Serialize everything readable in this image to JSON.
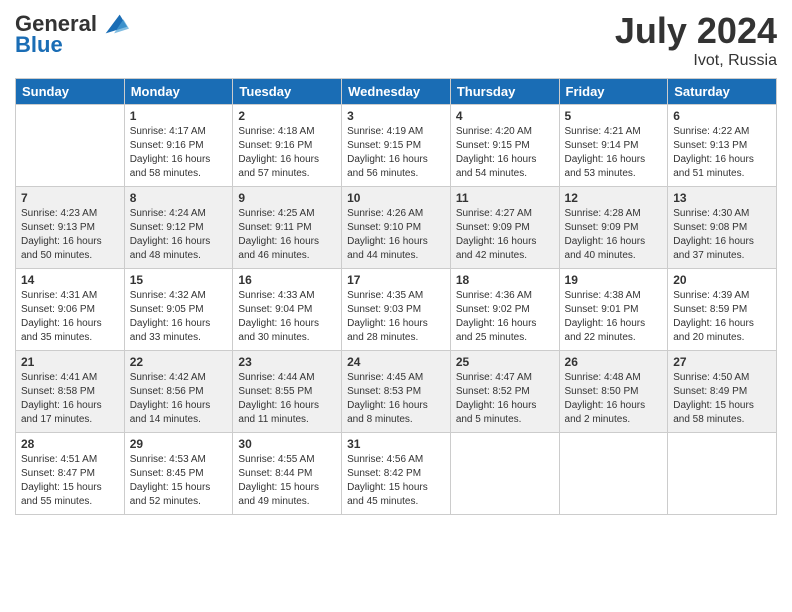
{
  "header": {
    "logo_line1": "General",
    "logo_line2": "Blue",
    "month_title": "July 2024",
    "location": "Ivot, Russia"
  },
  "weekdays": [
    "Sunday",
    "Monday",
    "Tuesday",
    "Wednesday",
    "Thursday",
    "Friday",
    "Saturday"
  ],
  "weeks": [
    [
      {
        "day": "",
        "content": ""
      },
      {
        "day": "1",
        "content": "Sunrise: 4:17 AM\nSunset: 9:16 PM\nDaylight: 16 hours\nand 58 minutes."
      },
      {
        "day": "2",
        "content": "Sunrise: 4:18 AM\nSunset: 9:16 PM\nDaylight: 16 hours\nand 57 minutes."
      },
      {
        "day": "3",
        "content": "Sunrise: 4:19 AM\nSunset: 9:15 PM\nDaylight: 16 hours\nand 56 minutes."
      },
      {
        "day": "4",
        "content": "Sunrise: 4:20 AM\nSunset: 9:15 PM\nDaylight: 16 hours\nand 54 minutes."
      },
      {
        "day": "5",
        "content": "Sunrise: 4:21 AM\nSunset: 9:14 PM\nDaylight: 16 hours\nand 53 minutes."
      },
      {
        "day": "6",
        "content": "Sunrise: 4:22 AM\nSunset: 9:13 PM\nDaylight: 16 hours\nand 51 minutes."
      }
    ],
    [
      {
        "day": "7",
        "content": "Sunrise: 4:23 AM\nSunset: 9:13 PM\nDaylight: 16 hours\nand 50 minutes."
      },
      {
        "day": "8",
        "content": "Sunrise: 4:24 AM\nSunset: 9:12 PM\nDaylight: 16 hours\nand 48 minutes."
      },
      {
        "day": "9",
        "content": "Sunrise: 4:25 AM\nSunset: 9:11 PM\nDaylight: 16 hours\nand 46 minutes."
      },
      {
        "day": "10",
        "content": "Sunrise: 4:26 AM\nSunset: 9:10 PM\nDaylight: 16 hours\nand 44 minutes."
      },
      {
        "day": "11",
        "content": "Sunrise: 4:27 AM\nSunset: 9:09 PM\nDaylight: 16 hours\nand 42 minutes."
      },
      {
        "day": "12",
        "content": "Sunrise: 4:28 AM\nSunset: 9:09 PM\nDaylight: 16 hours\nand 40 minutes."
      },
      {
        "day": "13",
        "content": "Sunrise: 4:30 AM\nSunset: 9:08 PM\nDaylight: 16 hours\nand 37 minutes."
      }
    ],
    [
      {
        "day": "14",
        "content": "Sunrise: 4:31 AM\nSunset: 9:06 PM\nDaylight: 16 hours\nand 35 minutes."
      },
      {
        "day": "15",
        "content": "Sunrise: 4:32 AM\nSunset: 9:05 PM\nDaylight: 16 hours\nand 33 minutes."
      },
      {
        "day": "16",
        "content": "Sunrise: 4:33 AM\nSunset: 9:04 PM\nDaylight: 16 hours\nand 30 minutes."
      },
      {
        "day": "17",
        "content": "Sunrise: 4:35 AM\nSunset: 9:03 PM\nDaylight: 16 hours\nand 28 minutes."
      },
      {
        "day": "18",
        "content": "Sunrise: 4:36 AM\nSunset: 9:02 PM\nDaylight: 16 hours\nand 25 minutes."
      },
      {
        "day": "19",
        "content": "Sunrise: 4:38 AM\nSunset: 9:01 PM\nDaylight: 16 hours\nand 22 minutes."
      },
      {
        "day": "20",
        "content": "Sunrise: 4:39 AM\nSunset: 8:59 PM\nDaylight: 16 hours\nand 20 minutes."
      }
    ],
    [
      {
        "day": "21",
        "content": "Sunrise: 4:41 AM\nSunset: 8:58 PM\nDaylight: 16 hours\nand 17 minutes."
      },
      {
        "day": "22",
        "content": "Sunrise: 4:42 AM\nSunset: 8:56 PM\nDaylight: 16 hours\nand 14 minutes."
      },
      {
        "day": "23",
        "content": "Sunrise: 4:44 AM\nSunset: 8:55 PM\nDaylight: 16 hours\nand 11 minutes."
      },
      {
        "day": "24",
        "content": "Sunrise: 4:45 AM\nSunset: 8:53 PM\nDaylight: 16 hours\nand 8 minutes."
      },
      {
        "day": "25",
        "content": "Sunrise: 4:47 AM\nSunset: 8:52 PM\nDaylight: 16 hours\nand 5 minutes."
      },
      {
        "day": "26",
        "content": "Sunrise: 4:48 AM\nSunset: 8:50 PM\nDaylight: 16 hours\nand 2 minutes."
      },
      {
        "day": "27",
        "content": "Sunrise: 4:50 AM\nSunset: 8:49 PM\nDaylight: 15 hours\nand 58 minutes."
      }
    ],
    [
      {
        "day": "28",
        "content": "Sunrise: 4:51 AM\nSunset: 8:47 PM\nDaylight: 15 hours\nand 55 minutes."
      },
      {
        "day": "29",
        "content": "Sunrise: 4:53 AM\nSunset: 8:45 PM\nDaylight: 15 hours\nand 52 minutes."
      },
      {
        "day": "30",
        "content": "Sunrise: 4:55 AM\nSunset: 8:44 PM\nDaylight: 15 hours\nand 49 minutes."
      },
      {
        "day": "31",
        "content": "Sunrise: 4:56 AM\nSunset: 8:42 PM\nDaylight: 15 hours\nand 45 minutes."
      },
      {
        "day": "",
        "content": ""
      },
      {
        "day": "",
        "content": ""
      },
      {
        "day": "",
        "content": ""
      }
    ]
  ]
}
